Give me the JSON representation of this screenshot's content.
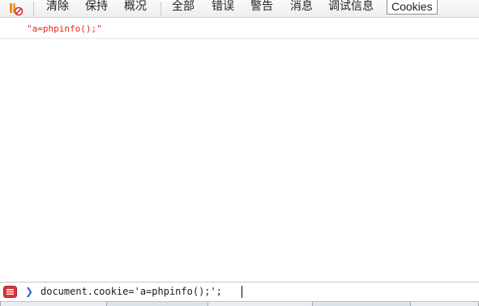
{
  "toolbar": {
    "icons": {
      "firebug": "firebug-bug-disabled-icon"
    },
    "buttons": {
      "clear": "清除",
      "persist": "保持",
      "profile": "概况",
      "all": "全部",
      "errors": "错误",
      "warnings": "警告",
      "info": "消息",
      "debug": "调试信息",
      "cookies": "Cookies"
    },
    "active_filter": "Cookies"
  },
  "console": {
    "entries": [
      {
        "text": "\"a=phpinfo();\"",
        "type": "string-result",
        "color": "#e8241c"
      }
    ]
  },
  "command_line": {
    "prompt": "❯",
    "value": "document.cookie='a=phpinfo();';",
    "menu_icon": "command-line-menu-icon"
  },
  "colors": {
    "result_text": "#e8241c",
    "prompt": "#3a67c6",
    "menu_icon_bg": "#d9363e"
  }
}
